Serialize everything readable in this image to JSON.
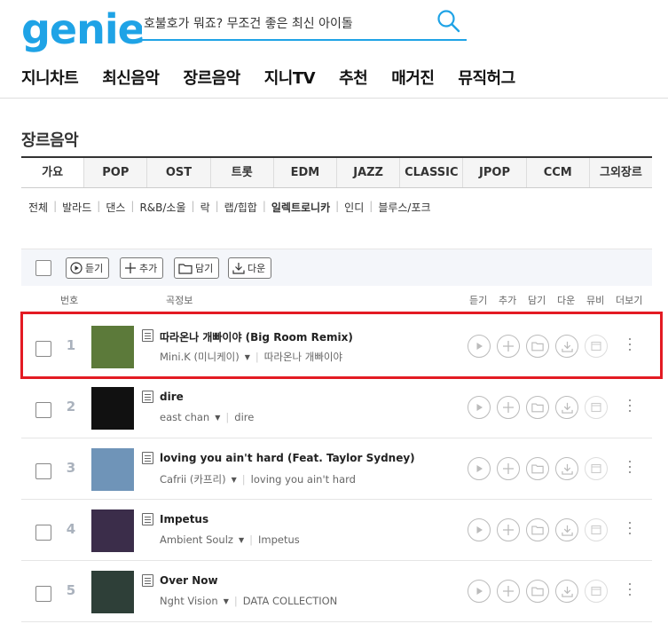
{
  "logo": "genie",
  "search": {
    "placeholder": "호불호가 뭐죠? 무조건 좋은 최신 아이돌"
  },
  "gnb": [
    "지니차트",
    "최신음악",
    "장르음악",
    "지니TV",
    "추천",
    "매거진",
    "뮤직허그"
  ],
  "page_title": "장르음악",
  "genre_tabs": [
    "가요",
    "POP",
    "OST",
    "트롯",
    "EDM",
    "JAZZ",
    "CLASSIC",
    "JPOP",
    "CCM",
    "그외장르"
  ],
  "active_tab": "가요",
  "subgenres": [
    "전체",
    "발라드",
    "댄스",
    "R&B/소울",
    "락",
    "랩/힙합",
    "일렉트로니카",
    "인디",
    "블루스/포크"
  ],
  "active_subgenre": "일렉트로니카",
  "toolbar": {
    "listen": "듣기",
    "add": "추가",
    "save": "담기",
    "download": "다운"
  },
  "columns": {
    "number": "번호",
    "info": "곡정보",
    "listen": "듣기",
    "add": "추가",
    "save": "담기",
    "download": "다운",
    "mv": "뮤비",
    "more": "더보기"
  },
  "tracks": [
    {
      "rank": "1",
      "title": "따라온나 개빠이야 (Big Room Remix)",
      "artist": "Mini.K (미니케이)",
      "album": "따라온나 개빠이야",
      "cover_color": "#5c7a3a"
    },
    {
      "rank": "2",
      "title": "dire",
      "artist": "east chan",
      "album": "dire",
      "cover_color": "#111111"
    },
    {
      "rank": "3",
      "title": "loving you ain't hard (Feat. Taylor Sydney)",
      "artist": "Cafrii (카프리)",
      "album": "loving you ain't hard",
      "cover_color": "#6f94b8"
    },
    {
      "rank": "4",
      "title": "Impetus",
      "artist": "Ambient Soulz",
      "album": "Impetus",
      "cover_color": "#3b2d4a"
    },
    {
      "rank": "5",
      "title": "Over Now",
      "artist": "Nght Vision",
      "album": "DATA COLLECTION",
      "cover_color": "#2e3f38"
    }
  ]
}
